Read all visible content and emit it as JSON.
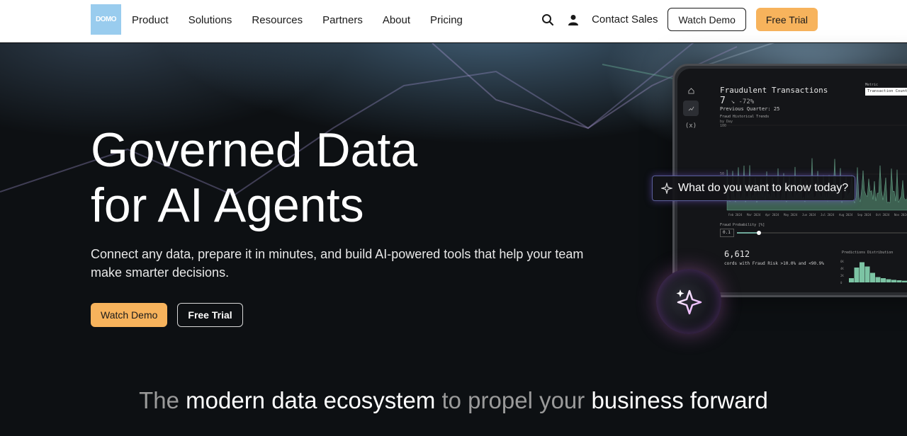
{
  "nav": {
    "logo_text": "DOMO",
    "links": [
      "Product",
      "Solutions",
      "Resources",
      "Partners",
      "About",
      "Pricing"
    ],
    "contact_label": "Contact Sales",
    "watch_demo_label": "Watch Demo",
    "free_trial_label": "Free Trial"
  },
  "hero": {
    "headline_line1": "Governed Data",
    "headline_line2": "for AI Agents",
    "subtext": "Connect any data, prepare it in minutes, and build AI-powered tools that help your team make smarter decisions.",
    "primary_button": "Watch Demo",
    "secondary_button": "Free Trial"
  },
  "device": {
    "title": "Fraudulent Transactions",
    "value": "7",
    "change": "↘ -72%",
    "previous": "Previous Quarter: 25",
    "fraud_trend_label": "Fraud Historical Trends",
    "by_day_label": "by Day",
    "metric_label": "Metric",
    "metric_value": "Transaction Count",
    "y_labels": [
      "100",
      "50"
    ],
    "months": [
      "Feb 2024",
      "Mar 2024",
      "Apr 2024",
      "May 2024",
      "Jun 2024",
      "Jul 2024",
      "Aug 2024",
      "Sep 2024",
      "Oct 2024",
      "Nov 2024",
      "Dec 2024"
    ],
    "fraud_prob_label": "Fraud Probability [%]",
    "fraud_prob_value": "0.1",
    "records_count": "6,612",
    "records_desc": "cords with Fraud Risk >10.0% and <90.9%",
    "pred_dist_label": "Predictions Distribution",
    "hist_y_labels": [
      "6K",
      "4K",
      "2K",
      "0"
    ]
  },
  "ask": {
    "text": "What do you want to know today?"
  },
  "tagline": {
    "part1": "The",
    "part2": "modern data ecosystem",
    "part3": "to propel your",
    "part4": "business forward"
  }
}
